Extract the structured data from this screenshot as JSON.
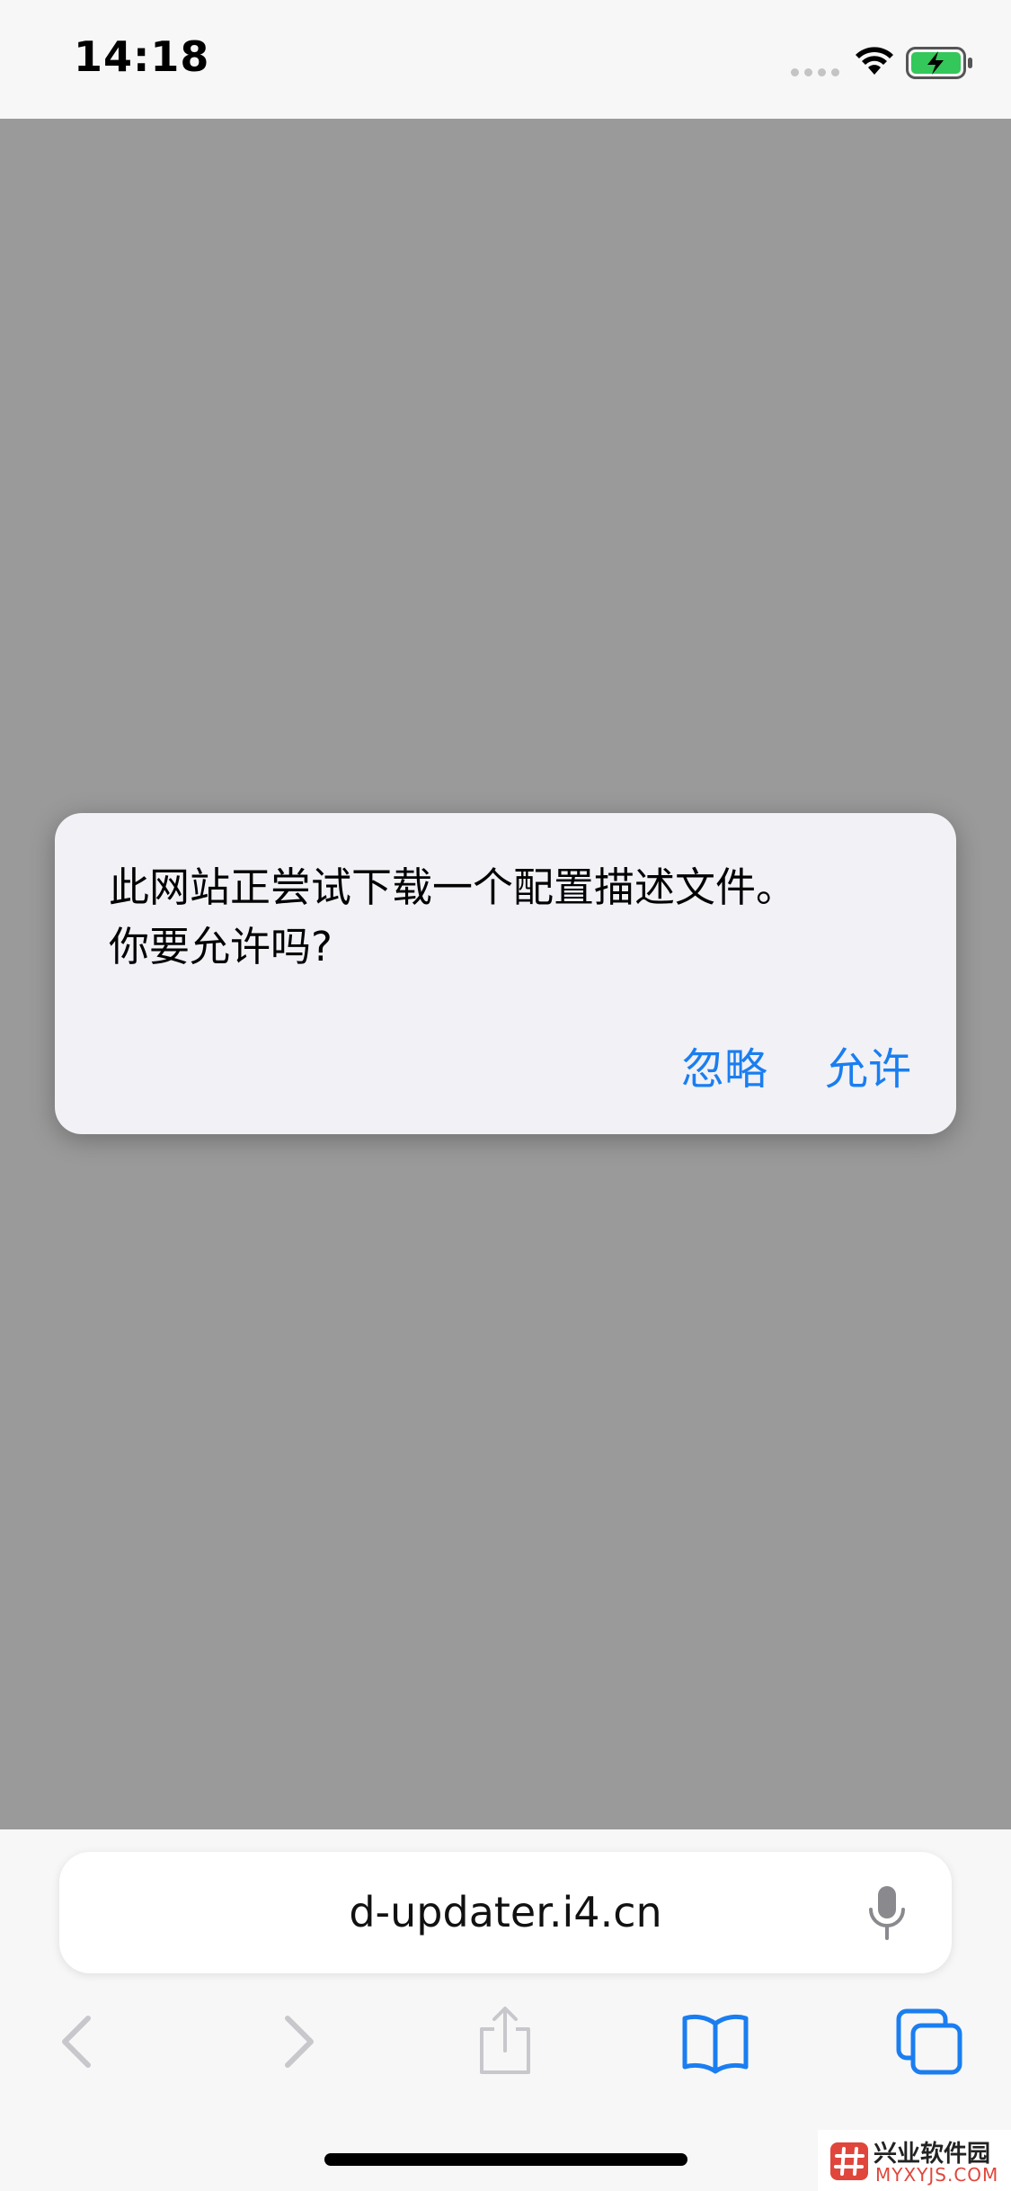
{
  "status_bar": {
    "time": "14:18"
  },
  "dialog": {
    "message": "此网站正尝试下载一个配置描述文件。\n你要允许吗?",
    "ignore_label": "忽略",
    "allow_label": "允许"
  },
  "toolbar": {
    "address": "d-updater.i4.cn",
    "icons": [
      "back-icon",
      "forward-icon",
      "share-icon",
      "bookmarks-icon",
      "tabs-icon",
      "mic-icon"
    ]
  },
  "watermark": {
    "title": "兴业软件园",
    "url": "MYXYJS.COM"
  },
  "colors": {
    "accent": "#1a7ef0",
    "dim_overlay": "#9a9a9a",
    "dialog_bg": "#f1f1f6",
    "battery_fill": "#34c759"
  }
}
